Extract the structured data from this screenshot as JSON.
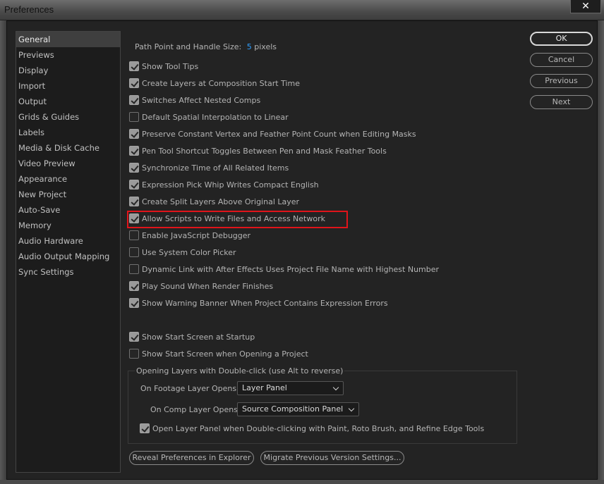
{
  "window": {
    "title": "Preferences",
    "close_label": "✕"
  },
  "sidebar": {
    "items": [
      {
        "label": "General",
        "selected": true
      },
      {
        "label": "Previews"
      },
      {
        "label": "Display"
      },
      {
        "label": "Import"
      },
      {
        "label": "Output"
      },
      {
        "label": "Grids & Guides"
      },
      {
        "label": "Labels"
      },
      {
        "label": "Media & Disk Cache"
      },
      {
        "label": "Video Preview"
      },
      {
        "label": "Appearance"
      },
      {
        "label": "New Project"
      },
      {
        "label": "Auto-Save"
      },
      {
        "label": "Memory"
      },
      {
        "label": "Audio Hardware"
      },
      {
        "label": "Audio Output Mapping"
      },
      {
        "label": "Sync Settings"
      }
    ]
  },
  "general": {
    "path_point_label": "Path Point and Handle Size:",
    "path_point_value": "5",
    "path_point_unit": "pixels",
    "options": [
      {
        "label": "Show Tool Tips",
        "checked": true
      },
      {
        "label": "Create Layers at Composition Start Time",
        "checked": true
      },
      {
        "label": "Switches Affect Nested Comps",
        "checked": true
      },
      {
        "label": "Default Spatial Interpolation to Linear",
        "checked": false
      },
      {
        "label": "Preserve Constant Vertex and Feather Point Count when Editing Masks",
        "checked": true
      },
      {
        "label": "Pen Tool Shortcut Toggles Between Pen and Mask Feather Tools",
        "checked": true
      },
      {
        "label": "Synchronize Time of All Related Items",
        "checked": true
      },
      {
        "label": "Expression Pick Whip Writes Compact English",
        "checked": true
      },
      {
        "label": "Create Split Layers Above Original Layer",
        "checked": true
      },
      {
        "label": "Allow Scripts to Write Files and Access Network",
        "checked": true
      },
      {
        "label": "Enable JavaScript Debugger",
        "checked": false
      },
      {
        "label": "Use System Color Picker",
        "checked": false
      },
      {
        "label": "Dynamic Link with After Effects Uses Project File Name with Highest Number",
        "checked": false
      },
      {
        "label": "Play Sound When Render Finishes",
        "checked": true
      },
      {
        "label": "Show Warning Banner When Project Contains Expression Errors",
        "checked": true
      }
    ],
    "startup_options": [
      {
        "label": "Show Start Screen at Startup",
        "checked": true
      },
      {
        "label": "Show Start Screen when Opening a Project",
        "checked": false
      }
    ],
    "opening_layers": {
      "title": "Opening Layers with Double-click (use Alt to reverse)",
      "footage_label": "On Footage Layer Opens:",
      "footage_value": "Layer Panel",
      "comp_label": "On Comp Layer Opens:",
      "comp_value": "Source Composition Panel",
      "open_layer_panel_label": "Open Layer Panel when Double-clicking with Paint, Roto Brush, and Refine Edge Tools",
      "open_layer_panel_checked": true
    }
  },
  "buttons": {
    "ok": "OK",
    "cancel": "Cancel",
    "previous": "Previous",
    "next": "Next",
    "reveal": "Reveal Preferences in Explorer",
    "migrate": "Migrate Previous Version Settings..."
  },
  "colors": {
    "highlight": "#e0141a",
    "accent_value": "#2e9fff"
  }
}
